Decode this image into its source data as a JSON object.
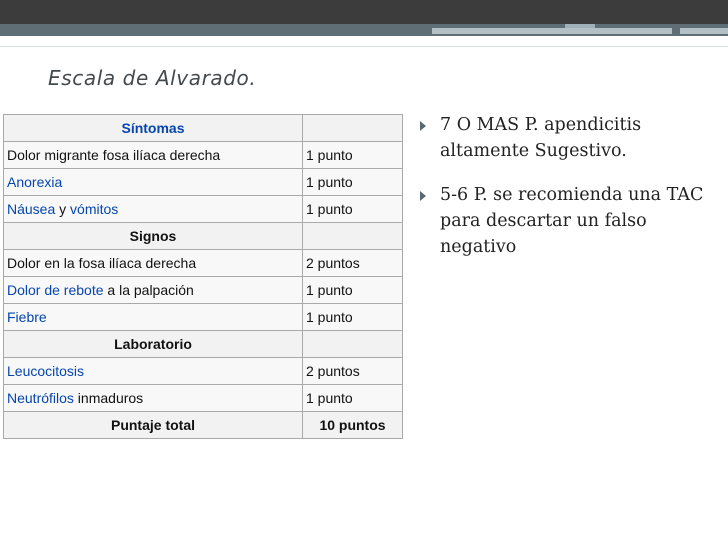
{
  "slide": {
    "title": "Escala de Alvarado.",
    "accent_color": "#5f6d75"
  },
  "table": {
    "sections": {
      "sintomas": "Síntomas",
      "signos": "Signos",
      "laboratorio": "Laboratorio"
    },
    "rows": {
      "dolor_migrante": {
        "label": "Dolor migrante fosa ilíaca derecha",
        "score": "1 punto"
      },
      "anorexia": {
        "label": "Anorexia",
        "score": "1 punto"
      },
      "nausea": {
        "label_link1": "Náusea",
        "label_mid": " y ",
        "label_link2": "vómitos",
        "score": "1 punto"
      },
      "dolor_fosa": {
        "label": "Dolor en la fosa ilíaca derecha",
        "score": "2 puntos"
      },
      "rebote": {
        "label_link": "Dolor de rebote",
        "label_rest": " a la palpación",
        "score": "1 punto"
      },
      "fiebre": {
        "label": "Fiebre",
        "score": "1 punto"
      },
      "leucocitosis": {
        "label": "Leucocitosis",
        "score": "2 puntos"
      },
      "neutrofilos": {
        "label_link": "Neutrófilos",
        "label_rest": " inmaduros",
        "score": "1 punto"
      }
    },
    "total": {
      "label": "Puntaje total",
      "score": "10 puntos"
    }
  },
  "bullets": [
    "7 O MAS P. apendicitis altamente Sugestivo.",
    "5-6 P. se recomienda  una TAC para descartar un falso negativo"
  ]
}
